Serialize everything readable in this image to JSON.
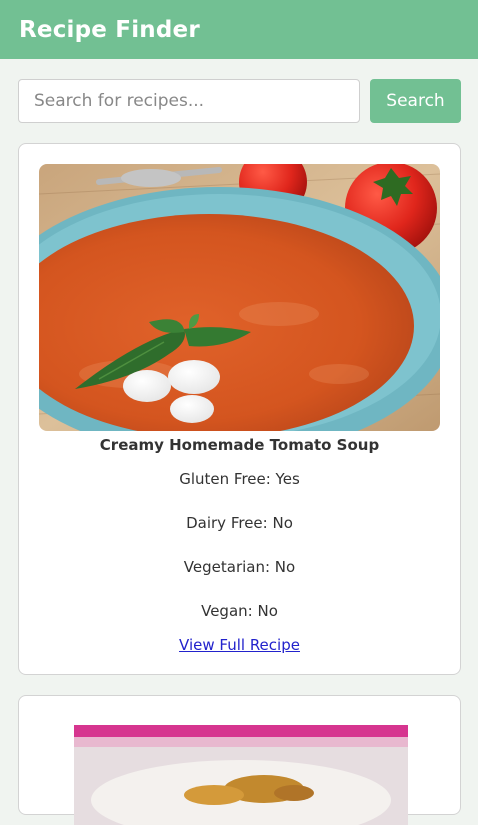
{
  "header": {
    "title": "Recipe Finder"
  },
  "search": {
    "placeholder": "Search for recipes...",
    "value": "",
    "button_label": "Search"
  },
  "recipes": [
    {
      "title": "Creamy Homemade Tomato Soup",
      "gluten_free": "Gluten Free: Yes",
      "dairy_free": "Dairy Free: No",
      "vegetarian": "Vegetarian: No",
      "vegan": "Vegan: No",
      "link_label": "View Full Recipe"
    }
  ],
  "colors": {
    "accent": "#72c093",
    "background": "#f0f4f0",
    "card": "#ffffff",
    "link": "#2222cc"
  }
}
